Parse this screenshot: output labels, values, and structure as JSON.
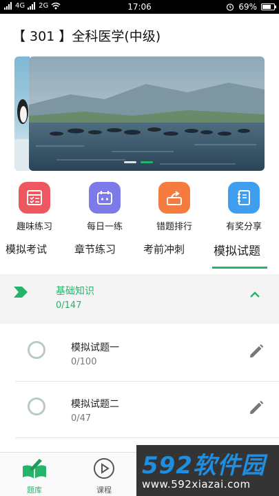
{
  "status_bar": {
    "carrier_1": "4G",
    "carrier_2": "2G",
    "time": "17:06",
    "battery": "69%",
    "battery_level": 0.69
  },
  "header": {
    "title": "【 301 】全科医学(中级)"
  },
  "banner": {
    "slide_count": 2,
    "active_index": 1
  },
  "quick_actions": [
    {
      "label": "趣味练习",
      "icon": "practice-form-icon",
      "color": "#ee5660"
    },
    {
      "label": "每日一练",
      "icon": "daily-calendar-icon",
      "color": "#7c79e8"
    },
    {
      "label": "错题排行",
      "icon": "ranking-share-icon",
      "color": "#f57b3f"
    },
    {
      "label": "有奖分享",
      "icon": "notebook-icon",
      "color": "#3f9ef0"
    }
  ],
  "tabs": [
    {
      "label": "模拟考试"
    },
    {
      "label": "章节练习"
    },
    {
      "label": "考前冲刺"
    },
    {
      "label": "模拟试题",
      "active": true
    }
  ],
  "section": {
    "title": "基础知识",
    "count": "0/147",
    "expanded": true
  },
  "exams": [
    {
      "title": "模拟试题一",
      "count": "0/100"
    },
    {
      "title": "模拟试题二",
      "count": "0/47"
    }
  ],
  "bottom_nav": [
    {
      "label": "题库",
      "icon": "book-pen-icon",
      "active": true
    },
    {
      "label": "课程",
      "icon": "play-circle-icon"
    }
  ],
  "watermark": {
    "brand": "592软件园",
    "url": "www.592xiazai.com"
  },
  "colors": {
    "accent": "#26b36b"
  }
}
